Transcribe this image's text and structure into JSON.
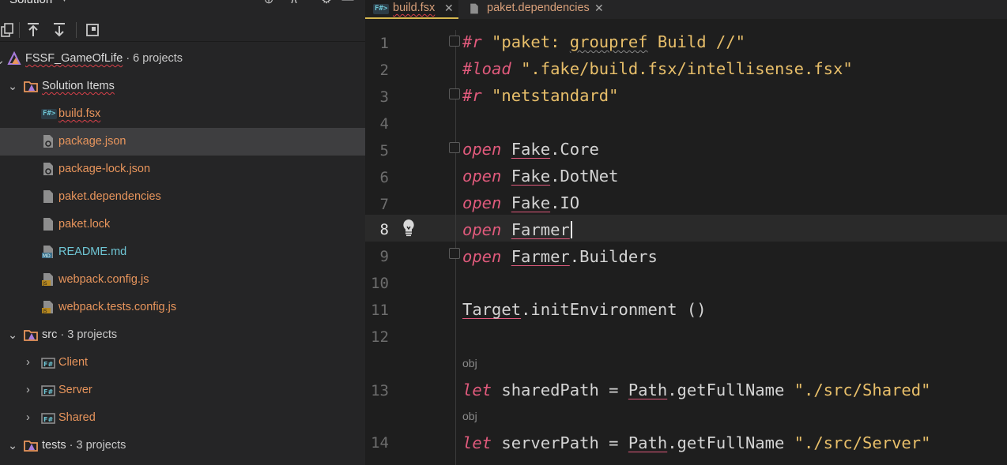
{
  "solution": {
    "title": "Solution",
    "root": {
      "name": "FSSF_GameOfLife",
      "meta": "· 6 projects"
    },
    "solution_items": {
      "label": "Solution Items",
      "files": [
        {
          "name": "build.fsx",
          "kind": "fsharp",
          "color": "orange"
        },
        {
          "name": "package.json",
          "kind": "gear",
          "color": "orange"
        },
        {
          "name": "package-lock.json",
          "kind": "gear",
          "color": "orange"
        },
        {
          "name": "paket.dependencies",
          "kind": "file",
          "color": "orange"
        },
        {
          "name": "paket.lock",
          "kind": "file",
          "color": "orange"
        },
        {
          "name": "README.md",
          "kind": "md",
          "color": "teal"
        },
        {
          "name": "webpack.config.js",
          "kind": "js",
          "color": "orange"
        },
        {
          "name": "webpack.tests.config.js",
          "kind": "js",
          "color": "orange"
        }
      ]
    },
    "src": {
      "name": "src",
      "meta": "· 3 projects",
      "projects": [
        "Client",
        "Server",
        "Shared"
      ]
    },
    "tests": {
      "name": "tests",
      "meta": "· 3 projects"
    }
  },
  "editor": {
    "tabs": [
      {
        "label": "build.fsx",
        "badge": "F#",
        "active": true
      },
      {
        "label": "paket.dependencies",
        "active": false
      }
    ],
    "close_glyph": "✕",
    "line_numbers": [
      "1",
      "2",
      "3",
      "4",
      "5",
      "6",
      "7",
      "8",
      "9",
      "10",
      "11",
      "12",
      "13",
      "14"
    ],
    "current_line": "8",
    "lines": {
      "l1": {
        "kw": "#r",
        "str1": "\"paket: ",
        "wavy": "groupref",
        "str2": " Build //\""
      },
      "l2": {
        "kw": "#load",
        "str": "\".fake/build.fsx/intellisense.fsx\""
      },
      "l3": {
        "kw": "#r",
        "str": "\"netstandard\""
      },
      "l5": {
        "kw": "open",
        "mod": "Fake",
        "rest": ".Core"
      },
      "l6": {
        "kw": "open",
        "mod": "Fake",
        "rest": ".DotNet"
      },
      "l7": {
        "kw": "open",
        "mod": "Fake",
        "rest": ".IO"
      },
      "l8": {
        "kw": "open",
        "mod": "Farmer",
        "rest": ""
      },
      "l9": {
        "kw": "open",
        "mod": "Farmer",
        "rest": ".Builders"
      },
      "l11": {
        "mod": "Target",
        "rest": ".initEnvironment ()"
      },
      "hint13": "obj",
      "l13": {
        "kw": "let",
        "name": " sharedPath = ",
        "mod": "Path",
        "rest": ".getFullName ",
        "str": "\"./src/Shared\""
      },
      "hint14": "obj",
      "l14": {
        "kw": "let",
        "name": " serverPath = ",
        "mod": "Path",
        "rest": ".getFullName ",
        "str": "\"./src/Server\""
      }
    }
  },
  "colors": {
    "accent": "#e05a7c",
    "string": "#e8bf6a",
    "file_orange": "#e8955c",
    "tab_underline": "#d6b74f"
  }
}
